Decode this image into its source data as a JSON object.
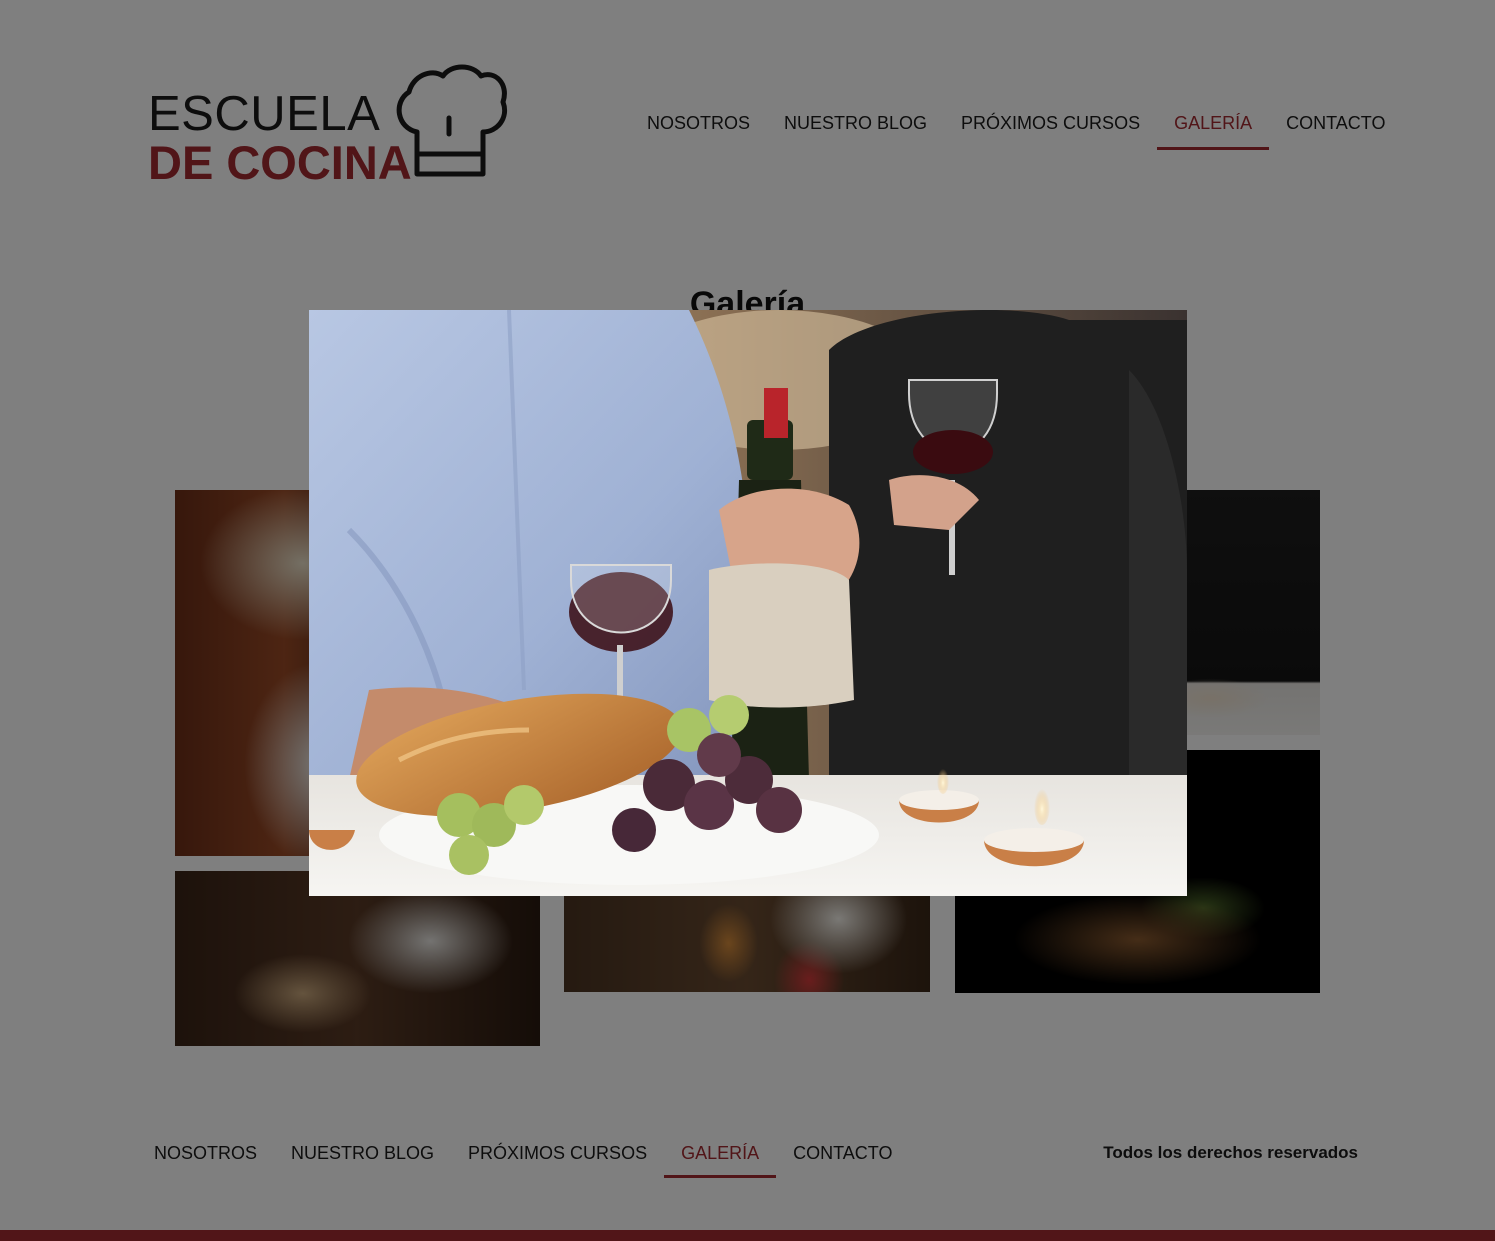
{
  "brand": {
    "line1": "ESCUELA",
    "line2": "DE COCINA",
    "icon": "chef-hat-icon",
    "accent_color": "#a32a31"
  },
  "nav": {
    "items": [
      {
        "label": "NOSOTROS"
      },
      {
        "label": "NUESTRO BLOG"
      },
      {
        "label": "PRÓXIMOS CURSOS"
      },
      {
        "label": "GALERÍA",
        "active": true
      },
      {
        "label": "CONTACTO"
      }
    ]
  },
  "gallery": {
    "title": "Galería"
  },
  "lightbox": {
    "open": true
  },
  "footer": {
    "nav": [
      {
        "label": "NOSOTROS"
      },
      {
        "label": "NUESTRO BLOG"
      },
      {
        "label": "PRÓXIMOS CURSOS"
      },
      {
        "label": "GALERÍA",
        "active": true
      },
      {
        "label": "CONTACTO"
      }
    ],
    "copyright": "Todos los derechos reservados"
  }
}
